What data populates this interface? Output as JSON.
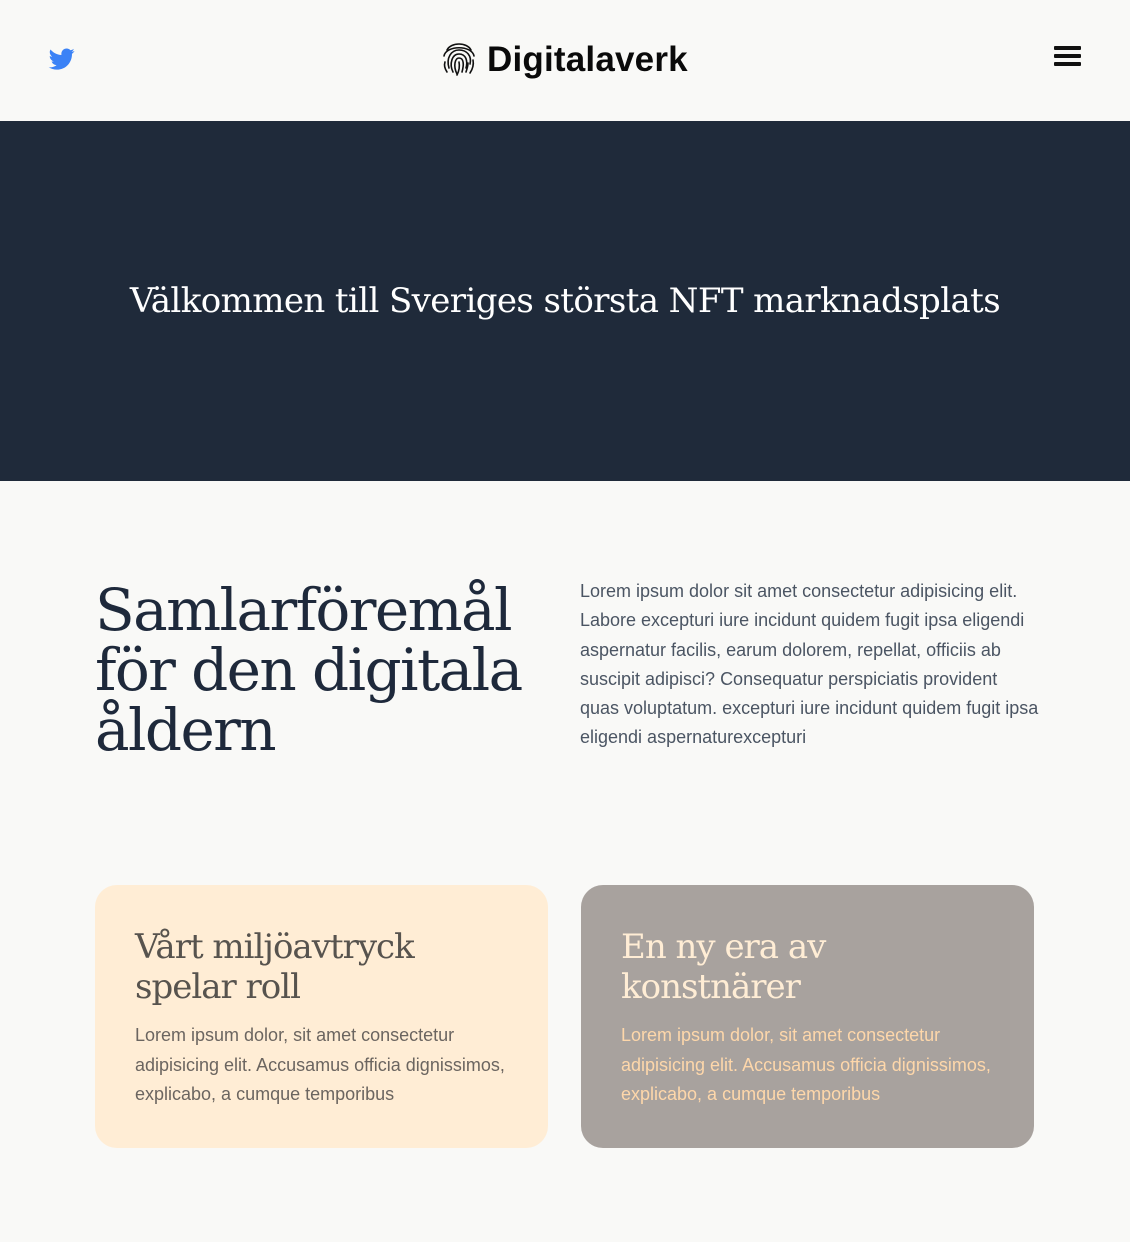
{
  "header": {
    "twitter_icon": "twitter-bird-icon",
    "brand_logo_icon": "fingerprint-icon",
    "brand_name": "Digitalaverk",
    "menu_icon": "hamburger-menu-icon"
  },
  "hero": {
    "title": "Välkommen till Sveriges största NFT marknadsplats"
  },
  "intro": {
    "heading": "Samlarföremål för den digitala åldern",
    "text": "Lorem ipsum dolor sit amet consectetur adipisicing elit. Labore excepturi iure incidunt quidem fugit ipsa eligendi aspernatur facilis, earum dolorem, repellat, officiis ab suscipit adipisci? Consequatur perspiciatis provident quas voluptatum. excepturi iure incidunt quidem fugit ipsa eligendi aspernaturexcepturi"
  },
  "cards": [
    {
      "title": "Vårt miljöavtryck spelar roll",
      "text": "Lorem ipsum dolor, sit amet consectetur adipisicing elit. Accusamus officia dignissimos, explicabo, a cumque temporibus"
    },
    {
      "title": "En ny era av konstnärer",
      "text": "Lorem ipsum dolor, sit amet consectetur adipisicing elit. Accusamus officia dignissimos, explicabo, a cumque temporibus"
    }
  ],
  "colors": {
    "hero_background": "#1f2a3a",
    "twitter_blue": "#3b82f6",
    "card_1_background": "#ffedd5",
    "card_2_background": "#a8a29e",
    "page_background": "#f9f9f7"
  }
}
